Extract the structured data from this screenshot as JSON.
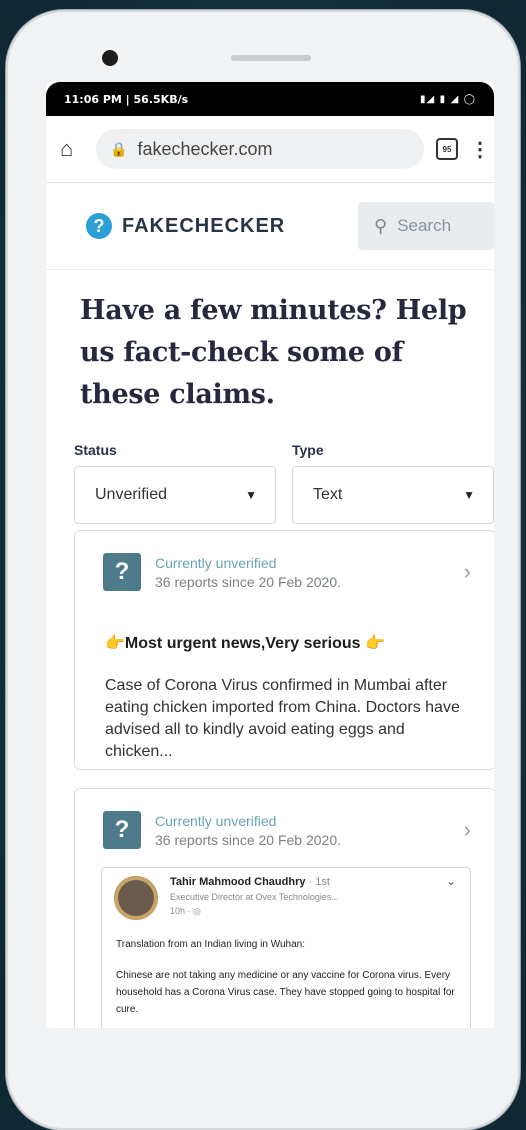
{
  "status_bar": {
    "left": "11:06 PM | 56.5KB/s",
    "right": "▮◢ ▮ ◢ ◯"
  },
  "browser": {
    "url": "fakechecker.com",
    "tabs_count": "95"
  },
  "site": {
    "logo_mark": "?",
    "logo_text": "FAKECHECKER",
    "search_label": "Search"
  },
  "hero": {
    "title": "Have a few minutes? Help us fact-check some of these claims."
  },
  "filters": {
    "status": {
      "label": "Status",
      "value": "Unverified"
    },
    "type": {
      "label": "Type",
      "value": "Text"
    }
  },
  "claims": [
    {
      "status": "Currently unverified",
      "reports": "36 reports since 20 Feb 2020.",
      "title": "👉Most urgent news,Very serious 👉",
      "body": "Case of Corona Virus confirmed in Mumbai after eating chicken imported from China. Doctors have advised all to kindly avoid eating eggs and chicken..."
    },
    {
      "status": "Currently unverified",
      "reports": "36 reports since 20 Feb 2020.",
      "embed": {
        "name": "Tahir Mahmood Chaudhry",
        "degree": "· 1st",
        "subtitle": "Executive Director at Ovex Technologies...",
        "time": "10h · ◎",
        "para1": "Translation from an Indian living in Wuhan:",
        "para2": "Chinese are not taking any medicine or any vaccine for Corona virus. Every household has a Corona Virus case. They have stopped going to hospital for cure."
      }
    }
  ]
}
